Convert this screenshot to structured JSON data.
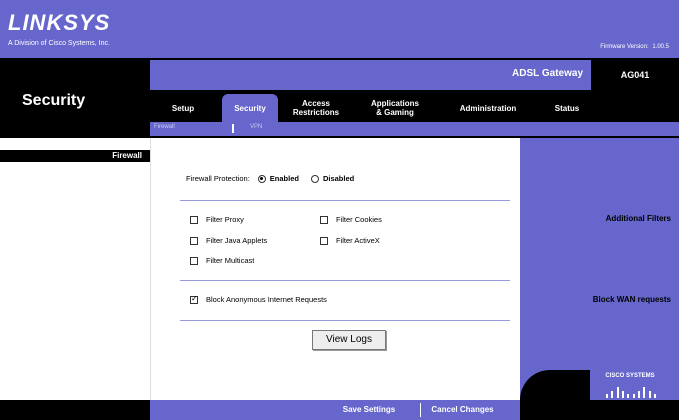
{
  "header": {
    "logo": "LINKSYS",
    "logo_sub": "A Division of Cisco Systems, Inc.",
    "firmware_label": "Firmware Version:",
    "firmware_value": "1.00.5"
  },
  "product": {
    "name": "ADSL Gateway",
    "model": "AG041"
  },
  "section_title": "Security",
  "tabs": [
    {
      "label": "Setup"
    },
    {
      "label": "Security"
    },
    {
      "label": "Access\nRestrictions"
    },
    {
      "label": "Applications\n& Gaming"
    },
    {
      "label": "Administration"
    },
    {
      "label": "Status"
    }
  ],
  "subtabs": {
    "firewall": "Firewall",
    "vpn": "VPN"
  },
  "left_labels": {
    "firewall": "Firewall",
    "additional_filters": "Additional Filters",
    "block_wan": "Block WAN requests"
  },
  "firewall_protection": {
    "label": "Firewall Protection:",
    "enabled": "Enabled",
    "disabled": "Disabled",
    "selected": "Enabled"
  },
  "filters": {
    "proxy": {
      "label": "Filter Proxy",
      "checked": false
    },
    "java": {
      "label": "Filter Java Applets",
      "checked": false
    },
    "multicast": {
      "label": "Filter Multicast",
      "checked": false
    },
    "cookies": {
      "label": "Filter Cookies",
      "checked": false
    },
    "activex": {
      "label": "Filter ActiveX",
      "checked": false
    }
  },
  "block_wan": {
    "label": "Block Anonymous Internet Requests",
    "checked": true
  },
  "buttons": {
    "view_logs": "View Logs",
    "save": "Save Settings",
    "cancel": "Cancel Changes"
  },
  "cisco": "CISCO SYSTEMS",
  "colors": {
    "brand_purple": "#6666cc",
    "black": "#000000"
  }
}
